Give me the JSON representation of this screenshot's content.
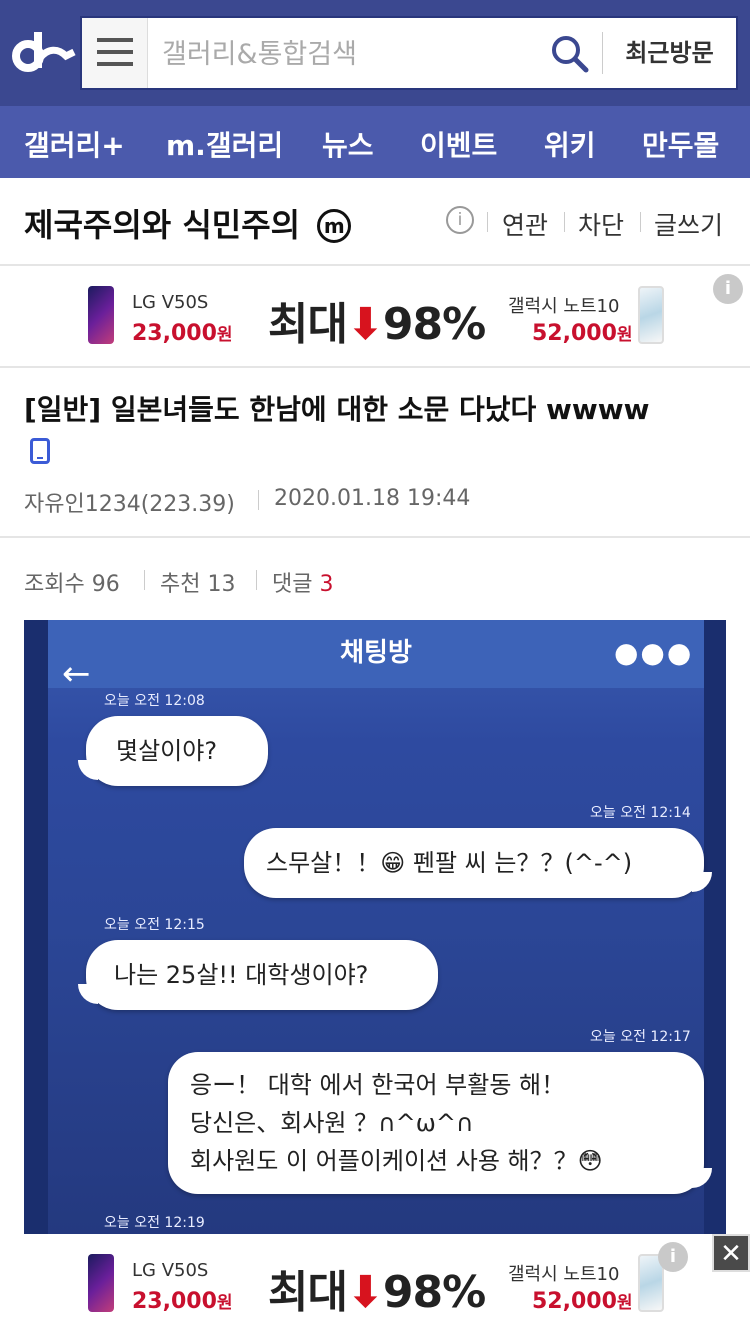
{
  "header": {
    "search_placeholder": "갤러리&통합검색",
    "recent_label": "최근방문"
  },
  "nav": [
    "갤러리+",
    "m.갤러리",
    "뉴스",
    "이벤트",
    "위키",
    "만두몰"
  ],
  "gallery": {
    "title": "제국주의와 식민주의",
    "badge": "m",
    "links": [
      "연관",
      "차단",
      "글쓰기"
    ]
  },
  "ad": {
    "left_name": "LG V50S",
    "left_price": "23,000",
    "won": "원",
    "big_text_1": "최대",
    "big_text_2": "98%",
    "right_name": "갤럭시 노트10",
    "right_price": "52,000"
  },
  "post": {
    "title": "[일반] 일본녀들도 한남에 대한 소문 다났다 wwww",
    "author": "자유인1234(223.39)",
    "date": "2020.01.18 19:44",
    "views_label": "조회수 96",
    "recommend_label": "추천 13",
    "comments_label": "댓글",
    "comments_count": "3"
  },
  "chat": {
    "title": "채팅방",
    "messages": [
      {
        "side": "left",
        "time": "오늘 오전 12:08",
        "text": "몇살이야?"
      },
      {
        "side": "right",
        "time": "오늘 오전 12:14",
        "text": "스무살！！😁 펜팔 씨 는？？(^-^)"
      },
      {
        "side": "left",
        "time": "오늘 오전 12:15",
        "text": "나는 25살!! 대학생이야?"
      },
      {
        "side": "right",
        "time": "오늘 오전 12:17",
        "lines": [
          "응ー！ 대학 에서 한국어 부활동 해！",
          "당신은、회사원 ？∩^ω^∩",
          "회사원도 이 어플이케이션 사용 해？？😳"
        ]
      },
      {
        "side": "left",
        "time": "오늘 오전 12:19"
      }
    ]
  },
  "close_label": "✕",
  "colors": {
    "topbar": "#3b4890",
    "gnb": "#4b5aac",
    "accent_red": "#c8102e"
  }
}
